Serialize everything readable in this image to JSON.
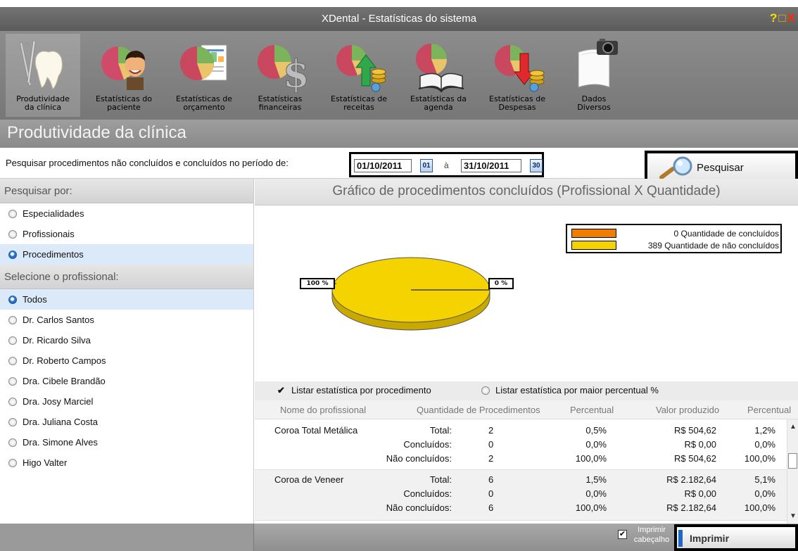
{
  "window": {
    "title": "XDental - Estatísticas do sistema",
    "controls": [
      "?",
      "□",
      "X"
    ]
  },
  "toolbar": {
    "items": [
      {
        "label": "Produtividade\nda clínica",
        "icon": "tooth-instruments-icon"
      },
      {
        "label": "Estatísticas do\npaciente",
        "icon": "pie-chart-person-icon"
      },
      {
        "label": "Estatísticas de\norçamento",
        "icon": "pie-chart-document-icon"
      },
      {
        "label": "Estatísticas\nfinanceiras",
        "icon": "pie-chart-dollar-icon"
      },
      {
        "label": "Estatísticas de\nreceitas",
        "icon": "pie-chart-arrow-up-coins-icon"
      },
      {
        "label": "Estatísticas da\nagenda",
        "icon": "pie-chart-book-icon"
      },
      {
        "label": "Estatísticas de\nDespesas",
        "icon": "pie-chart-arrow-down-coins-icon"
      },
      {
        "label": "Dados\nDiversos",
        "icon": "document-camera-icon"
      }
    ]
  },
  "section": {
    "title": "Produtividade da clínica"
  },
  "filter": {
    "label": "Pesquisar procedimentos não concluídos e concluídos no período de:",
    "date_from": "01/10/2011",
    "date_from_cal": "01",
    "separator": "à",
    "date_to": "31/10/2011",
    "date_to_cal": "30",
    "search_label": "Pesquisar"
  },
  "left": {
    "search_by_header": "Pesquisar por:",
    "search_by": [
      {
        "label": "Especialidades",
        "selected": false
      },
      {
        "label": "Profissionais",
        "selected": false
      },
      {
        "label": "Procedimentos",
        "selected": true
      }
    ],
    "professional_header": "Selecione o profissional:",
    "professionals": [
      {
        "label": "Todos",
        "selected": true
      },
      {
        "label": "Dr. Carlos Santos",
        "selected": false
      },
      {
        "label": "Dr. Ricardo Silva",
        "selected": false
      },
      {
        "label": "Dr. Roberto Campos",
        "selected": false
      },
      {
        "label": "Dra. Cibele Brandão",
        "selected": false
      },
      {
        "label": "Dra. Josy Marciel",
        "selected": false
      },
      {
        "label": "Dra. Juliana Costa",
        "selected": false
      },
      {
        "label": "Dra. Simone Alves",
        "selected": false
      },
      {
        "label": "Higo Valter",
        "selected": false
      }
    ]
  },
  "chart": {
    "title": "Gráfico de procedimentos concluídos (Profissional X Quantidade)",
    "legend": [
      {
        "text": "0 Quantidade de concluídos",
        "color": "#f07d00"
      },
      {
        "text": "389 Quantidade de não concluídos",
        "color": "#f5d300"
      }
    ],
    "label_left": "100 %",
    "label_right": "0 %"
  },
  "chart_data": {
    "type": "pie",
    "title": "Gráfico de procedimentos concluídos (Profissional X Quantidade)",
    "slices": [
      {
        "label": "Quantidade de concluídos",
        "value": 0,
        "percent": 0,
        "color": "#f07d00"
      },
      {
        "label": "Quantidade de não concluídos",
        "value": 389,
        "percent": 100,
        "color": "#f5d300"
      }
    ],
    "legend_position": "top-right"
  },
  "list_options": {
    "by_procedure": "Listar estatística por procedimento",
    "by_percent": "Listar estatística por maior percentual %"
  },
  "table": {
    "headers": [
      "Nome do profissional",
      "Quantidade de Procedimentos",
      "Percentual",
      "Valor produzido",
      "Percentual"
    ],
    "groups": [
      {
        "name": "Coroa Total Metálica",
        "rows": [
          {
            "kind": "Total:",
            "qty": "2",
            "pct": "0,5%",
            "value": "R$ 504,62",
            "vpct": "1,2%"
          },
          {
            "kind": "Concluídos:",
            "qty": "0",
            "pct": "0,0%",
            "value": "R$ 0,00",
            "vpct": "0,0%"
          },
          {
            "kind": "Não concluídos:",
            "qty": "2",
            "pct": "100,0%",
            "value": "R$ 504,62",
            "vpct": "100,0%"
          }
        ]
      },
      {
        "name": "Coroa de Veneer",
        "rows": [
          {
            "kind": "Total:",
            "qty": "6",
            "pct": "1,5%",
            "value": "R$ 2.182,64",
            "vpct": "5,1%"
          },
          {
            "kind": "Concluídos:",
            "qty": "0",
            "pct": "0,0%",
            "value": "R$ 0,00",
            "vpct": "0,0%"
          },
          {
            "kind": "Não concluídos:",
            "qty": "6",
            "pct": "100,0%",
            "value": "R$ 2.182,64",
            "vpct": "100,0%"
          }
        ]
      }
    ]
  },
  "footer": {
    "print_header_label": "Imprimir cabeçalho",
    "print_header_checked": true,
    "print_label": "Imprimir"
  }
}
